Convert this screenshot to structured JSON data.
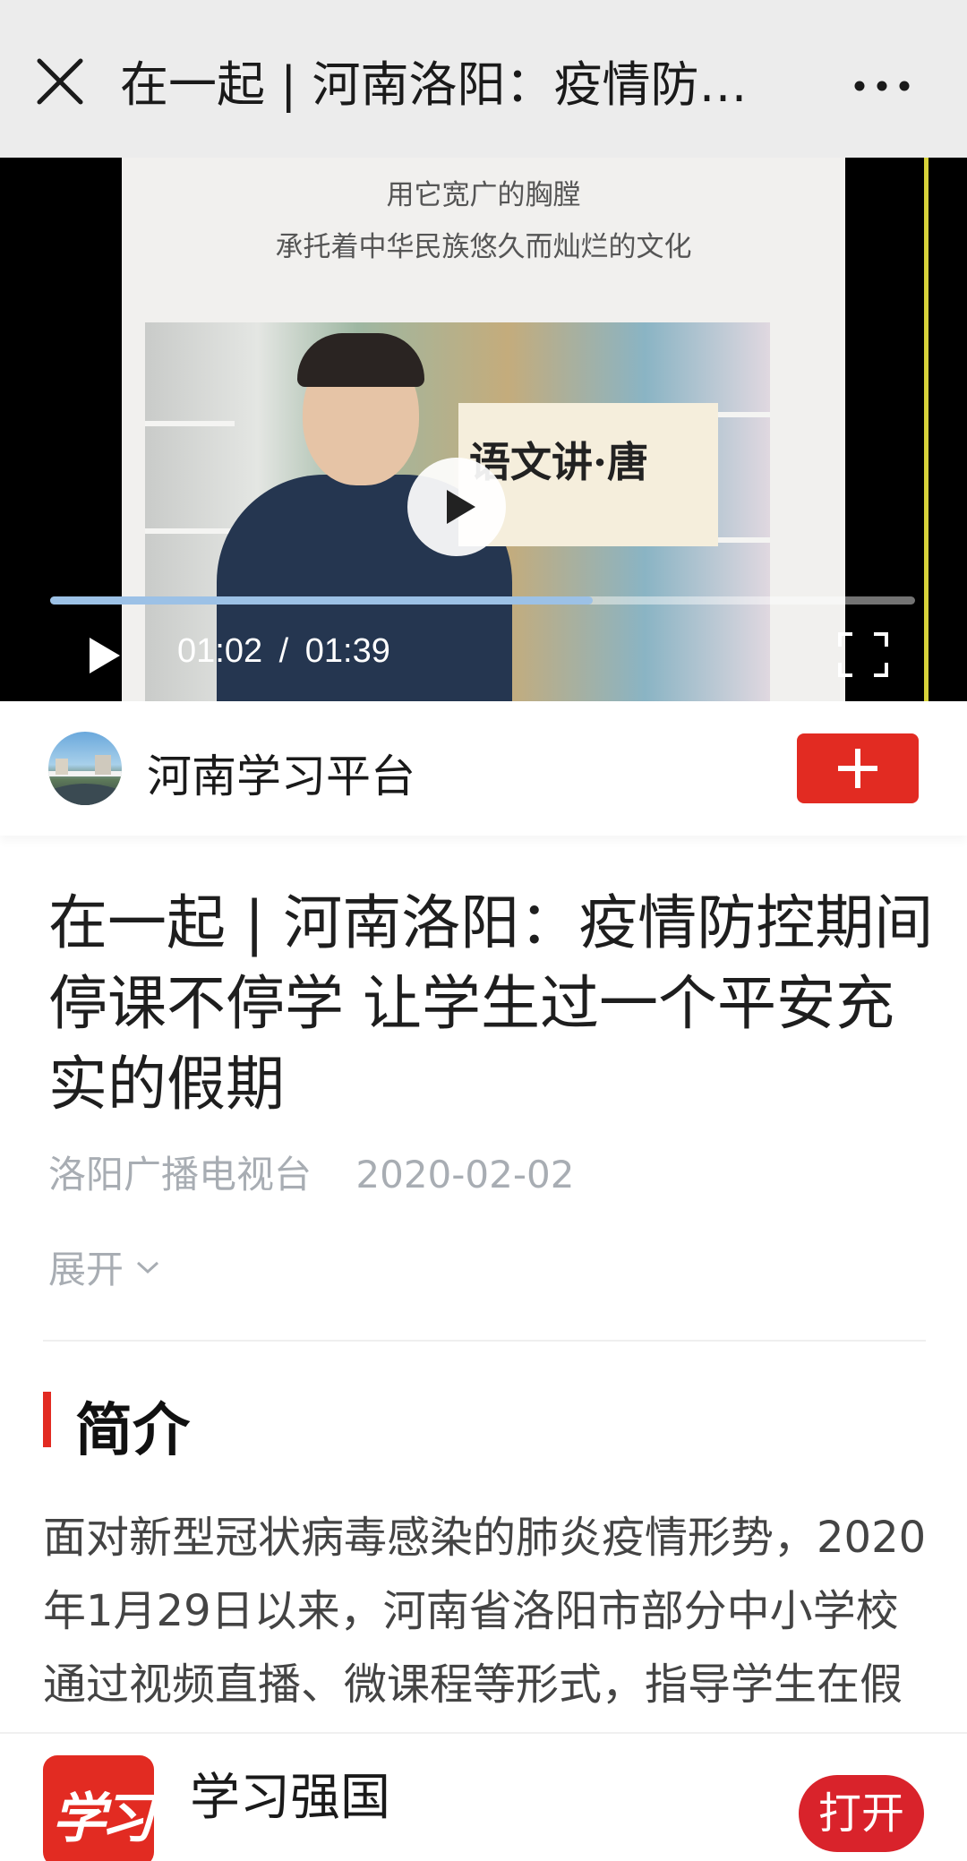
{
  "topbar": {
    "title": "在一起 | 河南洛阳：疫情防…",
    "close_icon": "close-icon",
    "more_icon": "more-dots-icon"
  },
  "video": {
    "caption_line1": "用它宽广的胸膛",
    "caption_line2": "承托着中华民族悠久而灿烂的文化",
    "sign_text": "语文讲·唐",
    "current_time": "01:02",
    "separator": "/",
    "duration": "01:39",
    "progress_fraction": 0.627,
    "play_icon": "play-icon",
    "fullscreen_icon": "fullscreen-icon"
  },
  "account": {
    "name": "河南学习平台",
    "follow_icon": "plus-icon"
  },
  "article": {
    "title": "在一起 | 河南洛阳：疫情防控期间停课不停学 让学生过一个平安充实的假期",
    "source": "洛阳广播电视台",
    "date": "2020-02-02",
    "expand_label": "展开",
    "section_title": "简介",
    "intro": "面对新型冠状病毒感染的肺炎疫情形势，2020年1月29日以来，河南省洛阳市部分中小学校通过视频直播、微课程等形式，指导学生在假期学习"
  },
  "bottom": {
    "app_logo_text": "学习",
    "app_name": "学习强国",
    "open_label": "打开"
  },
  "colors": {
    "accent": "#e22b22",
    "topbar_bg": "#ececec",
    "meta_gray": "#a8adb3",
    "progress_fill": "#9cc1e6"
  }
}
